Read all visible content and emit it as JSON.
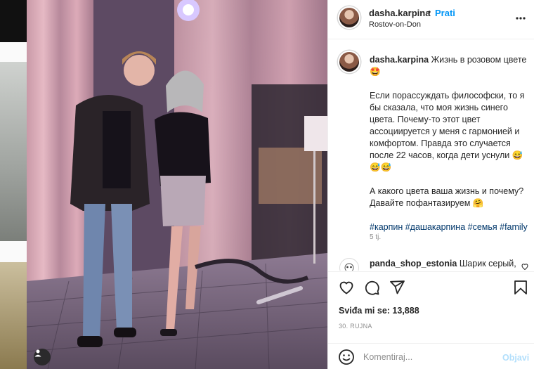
{
  "post": {
    "username": "dasha.karpina",
    "follow_label": "Prati",
    "separator": "•",
    "location": "Rostov-on-Don",
    "more_icon": "more-horizontal-icon"
  },
  "caption": {
    "username": "dasha.karpina",
    "line1": "Жизнь в розовом цвете 🤩",
    "para1": "Если порассуждать философски, то я бы сказала, что моя жизнь синего цвета. Почему-то этот цвет ассоциируется у меня с гармонией и комфортом. Правда это случается после 22 часов, когда дети уснули 😅😅😅",
    "para2": "А какого цвета ваша жизнь и почему? Давайте пофантазируем 🤗",
    "hashtags": "#карпин #дашакарпина #семья #family",
    "time": "5 tj."
  },
  "comment": {
    "username": "panda_shop_estonia",
    "text": "Шарик серый,"
  },
  "actions": {
    "likes_label": "Sviđa mi se: 13,888",
    "date": "30. RUJNA",
    "icons": [
      "heart-icon",
      "comment-icon",
      "share-icon",
      "bookmark-icon"
    ]
  },
  "add_comment": {
    "placeholder": "Komentiraj...",
    "post_label": "Objavi"
  },
  "colors": {
    "accent": "#0095f6",
    "post_disabled": "#b2dffc",
    "link": "#00376b",
    "muted": "#8e8e8e"
  }
}
